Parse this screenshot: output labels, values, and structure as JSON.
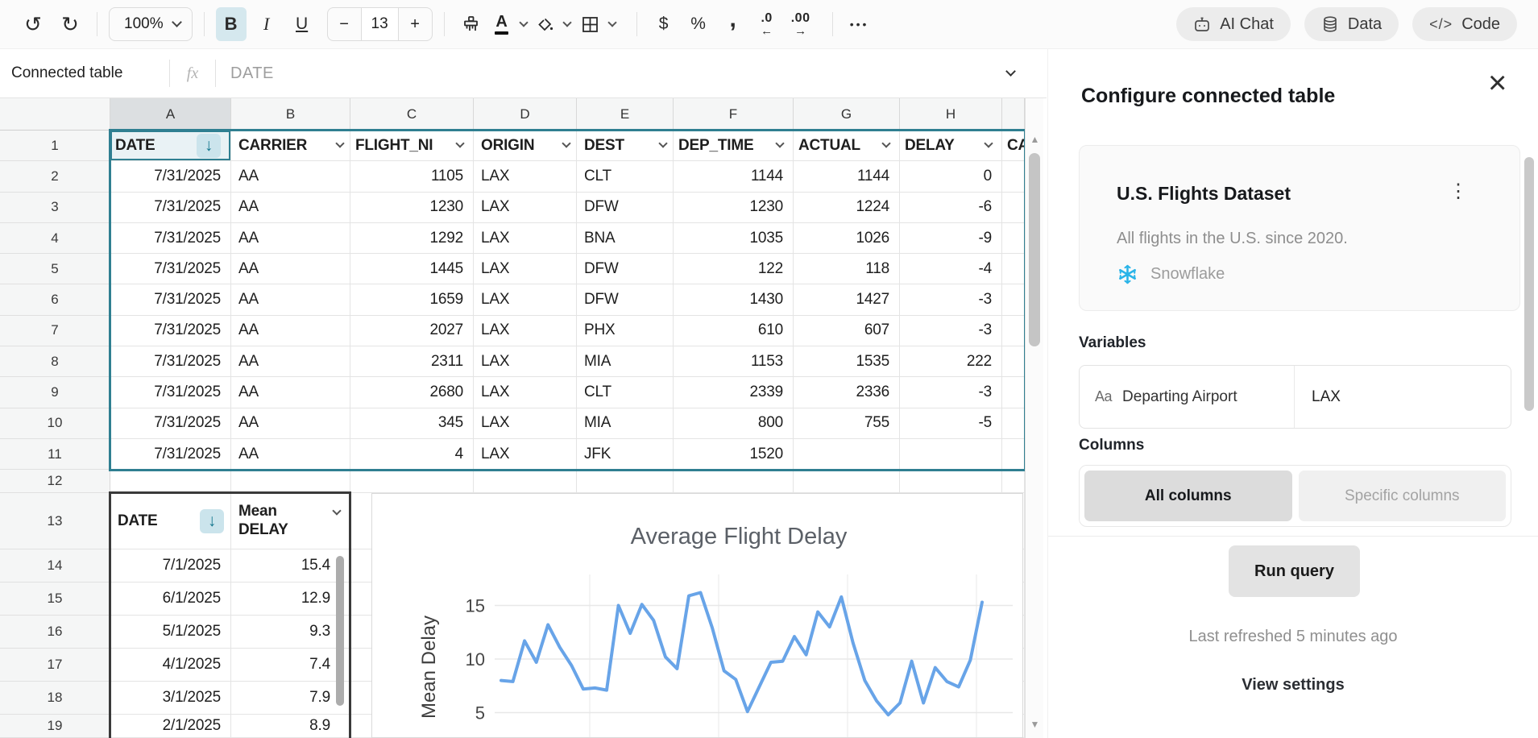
{
  "toolbar": {
    "zoom": "100%",
    "bold": "B",
    "italic": "I",
    "underline": "U",
    "decrease_font": "−",
    "font_size": "13",
    "increase_font": "+",
    "text_color_letter": "A",
    "currency": "$",
    "percent": "%",
    "comma": ",",
    "decrease_decimal": ".0",
    "decrease_decimal_arrow": "←",
    "increase_decimal": ".00",
    "increase_decimal_arrow": "→",
    "more": "•••",
    "ai_chat": "AI Chat",
    "data": "Data",
    "code": "Code",
    "code_glyph": "</>"
  },
  "formula_bar": {
    "name_box": "Connected table",
    "fx": "fx",
    "value": "DATE"
  },
  "grid": {
    "column_letters": [
      "A",
      "B",
      "C",
      "D",
      "E",
      "F",
      "G",
      "H"
    ],
    "active_column": "A",
    "table1": {
      "headers": [
        "DATE",
        "CARRIER",
        "FLIGHT_NI",
        "ORIGIN",
        "DEST",
        "DEP_TIME",
        "ACTUAL",
        "DELAY",
        "CA"
      ],
      "rows": [
        [
          "7/31/2025",
          "AA",
          "1105",
          "LAX",
          "CLT",
          "1144",
          "1144",
          "0",
          ""
        ],
        [
          "7/31/2025",
          "AA",
          "1230",
          "LAX",
          "DFW",
          "1230",
          "1224",
          "-6",
          ""
        ],
        [
          "7/31/2025",
          "AA",
          "1292",
          "LAX",
          "BNA",
          "1035",
          "1026",
          "-9",
          ""
        ],
        [
          "7/31/2025",
          "AA",
          "1445",
          "LAX",
          "DFW",
          "122",
          "118",
          "-4",
          ""
        ],
        [
          "7/31/2025",
          "AA",
          "1659",
          "LAX",
          "DFW",
          "1430",
          "1427",
          "-3",
          ""
        ],
        [
          "7/31/2025",
          "AA",
          "2027",
          "LAX",
          "PHX",
          "610",
          "607",
          "-3",
          ""
        ],
        [
          "7/31/2025",
          "AA",
          "2311",
          "LAX",
          "MIA",
          "1153",
          "1535",
          "222",
          ""
        ],
        [
          "7/31/2025",
          "AA",
          "2680",
          "LAX",
          "CLT",
          "2339",
          "2336",
          "-3",
          ""
        ],
        [
          "7/31/2025",
          "AA",
          "345",
          "LAX",
          "MIA",
          "800",
          "755",
          "-5",
          ""
        ],
        [
          "7/31/2025",
          "AA",
          "4",
          "LAX",
          "JFK",
          "1520",
          "",
          "",
          ""
        ]
      ]
    },
    "table2": {
      "headers": [
        "DATE",
        "Mean DELAY"
      ],
      "rows": [
        [
          "7/1/2025",
          "15.4"
        ],
        [
          "6/1/2025",
          "12.9"
        ],
        [
          "5/1/2025",
          "9.3"
        ],
        [
          "4/1/2025",
          "7.4"
        ],
        [
          "3/1/2025",
          "7.9"
        ],
        [
          "2/1/2025",
          "8.9"
        ]
      ]
    }
  },
  "chart_data": {
    "type": "line",
    "title": "Average Flight Delay",
    "ylabel": "Mean Delay",
    "yticks": [
      5,
      10,
      15
    ],
    "ylim": [
      2.5,
      17.5
    ],
    "x_axis_labels_visible": false,
    "line_color": "#68a4e8",
    "series": [
      {
        "name": "Mean Delay",
        "values": [
          8.0,
          7.9,
          11.7,
          9.7,
          13.2,
          11.1,
          9.4,
          7.2,
          7.3,
          7.1,
          15.0,
          12.4,
          15.1,
          13.6,
          10.2,
          9.1,
          15.9,
          16.2,
          12.9,
          8.9,
          8.1,
          5.1,
          7.4,
          9.7,
          9.8,
          12.1,
          10.4,
          14.4,
          13.0,
          15.8,
          11.5,
          8.0,
          6.1,
          4.8,
          5.9,
          9.8,
          5.9,
          9.2,
          7.9,
          7.4,
          9.9,
          15.3
        ]
      }
    ]
  },
  "panel": {
    "title": "Configure connected table",
    "card": {
      "title": "U.S. Flights Dataset",
      "description": "All flights in the U.S. since 2020.",
      "source": "Snowflake"
    },
    "variables_label": "Variables",
    "variable": {
      "type_icon": "Aa",
      "name": "Departing Airport",
      "value": "LAX"
    },
    "columns_label": "Columns",
    "all_columns": "All columns",
    "specific_columns": "Specific columns",
    "run_query": "Run query",
    "last_refreshed": "Last refreshed 5 minutes ago",
    "view_settings": "View settings"
  }
}
